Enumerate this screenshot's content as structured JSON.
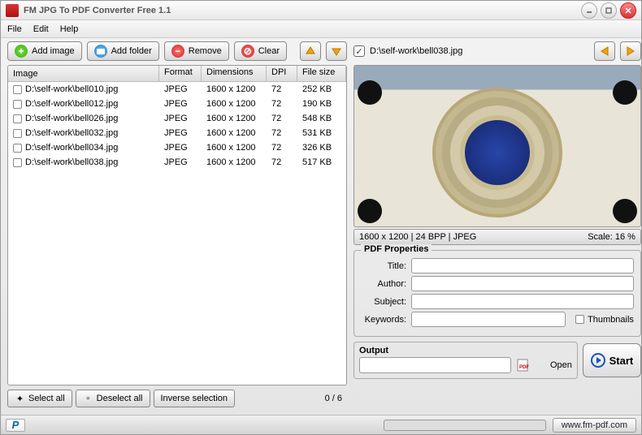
{
  "window": {
    "title": "FM JPG To PDF Converter Free 1.1"
  },
  "menu": {
    "file": "File",
    "edit": "Edit",
    "help": "Help"
  },
  "toolbar": {
    "add_image": "Add image",
    "add_folder": "Add folder",
    "remove": "Remove",
    "clear": "Clear"
  },
  "columns": {
    "image": "Image",
    "format": "Format",
    "dimensions": "Dimensions",
    "dpi": "DPI",
    "filesize": "File size"
  },
  "files": [
    {
      "path": "D:\\self-work\\bell010.jpg",
      "format": "JPEG",
      "dimensions": "1600 x 1200",
      "dpi": "72",
      "size": "252 KB"
    },
    {
      "path": "D:\\self-work\\bell012.jpg",
      "format": "JPEG",
      "dimensions": "1600 x 1200",
      "dpi": "72",
      "size": "190 KB"
    },
    {
      "path": "D:\\self-work\\bell026.jpg",
      "format": "JPEG",
      "dimensions": "1600 x 1200",
      "dpi": "72",
      "size": "548 KB"
    },
    {
      "path": "D:\\self-work\\bell032.jpg",
      "format": "JPEG",
      "dimensions": "1600 x 1200",
      "dpi": "72",
      "size": "531 KB"
    },
    {
      "path": "D:\\self-work\\bell034.jpg",
      "format": "JPEG",
      "dimensions": "1600 x 1200",
      "dpi": "72",
      "size": "326 KB"
    },
    {
      "path": "D:\\self-work\\bell038.jpg",
      "format": "JPEG",
      "dimensions": "1600 x 1200",
      "dpi": "72",
      "size": "517 KB"
    }
  ],
  "selection": {
    "select_all": "Select all",
    "deselect_all": "Deselect all",
    "inverse": "Inverse selection",
    "counter": "0 / 6"
  },
  "preview": {
    "filename": "D:\\self-work\\bell038.jpg",
    "info": "1600 x 1200  |  24 BPP  |  JPEG",
    "scale": "Scale: 16 %"
  },
  "pdf": {
    "legend": "PDF Properties",
    "title_label": "Title:",
    "author_label": "Author:",
    "subject_label": "Subject:",
    "keywords_label": "Keywords:",
    "thumbnails": "Thumbnails",
    "title": "",
    "author": "",
    "subject": "",
    "keywords": ""
  },
  "output": {
    "legend": "Output",
    "path": "",
    "open": "Open",
    "start": "Start"
  },
  "status": {
    "site": "www.fm-pdf.com"
  }
}
